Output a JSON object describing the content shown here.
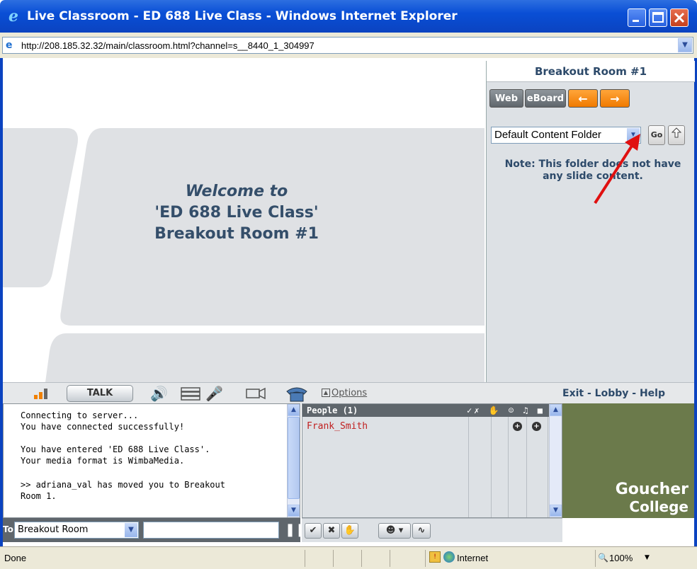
{
  "window": {
    "title": "Live Classroom - ED 688 Live Class - Windows Internet Explorer"
  },
  "address": {
    "url": "http://208.185.32.32/main/classroom.html?channel=s__8440_1_304997"
  },
  "slide": {
    "line1": "Welcome to",
    "line2": "'ED 688 Live Class'",
    "line3": "Breakout Room #1"
  },
  "panel": {
    "title": "Breakout Room #1",
    "buttons": {
      "web": "Web",
      "eboard": "eBoard",
      "prev": "←",
      "next": "→"
    },
    "folder": "Default Content Folder",
    "go": "Go",
    "note": "Note: This folder does not have any slide content."
  },
  "toolbar": {
    "talk": "TALK",
    "options": "Options",
    "exit": "Exit",
    "lobby": "Lobby",
    "help": "Help"
  },
  "chat": {
    "messages": [
      "Connecting to server...",
      "You have connected successfully!",
      "You have entered 'ED 688 Live Class'.",
      "Your media format is WimbaMedia.",
      ">> adriana_val has moved you to Breakout",
      "Room 1."
    ],
    "to_label": "To:",
    "to_value": "Breakout Room"
  },
  "people": {
    "header": "People (1)",
    "rows": [
      {
        "name": "Frank_Smith"
      }
    ]
  },
  "video": {
    "logo_line1": "Goucher",
    "logo_line2": "College"
  },
  "status": {
    "text": "Done",
    "zone": "Internet",
    "zoom": "100%"
  },
  "colors": {
    "title_bar": "#0b43c0",
    "panel_title": "#2d4a6a",
    "person": "#c02020",
    "orange": "#f07a00"
  }
}
